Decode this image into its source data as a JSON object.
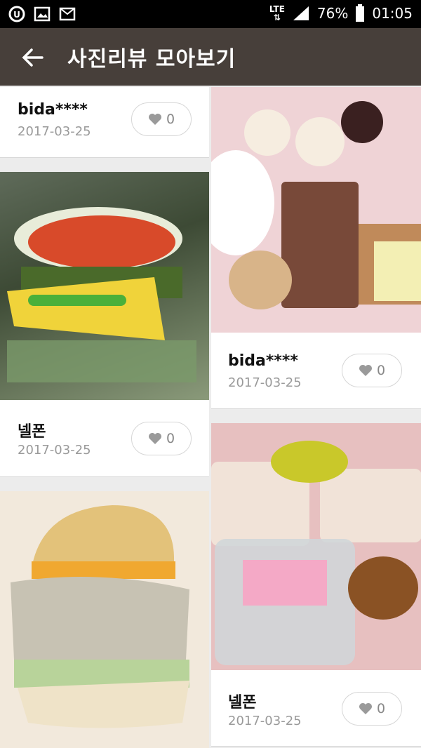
{
  "status_bar": {
    "network": "LTE",
    "battery": "76%",
    "time": "01:05"
  },
  "header": {
    "title": "사진리뷰 모아보기"
  },
  "reviews": [
    {
      "user": "bida****",
      "date": "2017-03-25",
      "likes": "0"
    },
    {
      "user": "넬폰",
      "date": "2017-03-25",
      "likes": "0"
    },
    {
      "user": "bida****",
      "date": "2017-03-25",
      "likes": "0"
    },
    {
      "user": "넬폰",
      "date": "2017-03-25",
      "likes": "0"
    }
  ],
  "icons": [
    "uplus-icon",
    "image-icon",
    "mail-icon",
    "signal-icon",
    "battery-icon",
    "back-arrow-icon",
    "heart-icon"
  ]
}
